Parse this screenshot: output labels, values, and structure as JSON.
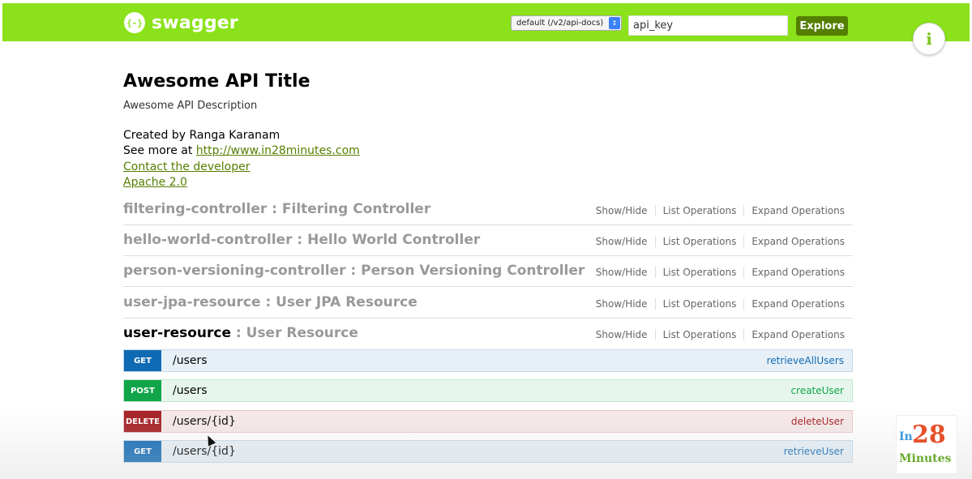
{
  "header": {
    "logo_mark": "{-}",
    "logo_text": "swagger",
    "spec_select_value": "default (/v2/api-docs)",
    "api_key_placeholder": "api_key",
    "explore_label": "Explore",
    "info_icon": "i"
  },
  "info": {
    "title": "Awesome API Title",
    "description": "Awesome API Description",
    "created_by": "Created by Ranga Karanam",
    "see_more_prefix": "See more at ",
    "see_more_link": "http://www.in28minutes.com",
    "contact_link": "Contact the developer",
    "license_link": "Apache 2.0"
  },
  "resource_actions": {
    "show_hide": "Show/Hide",
    "list_operations": "List Operations",
    "expand_operations": "Expand Operations"
  },
  "resources": [
    {
      "name": "filtering-controller",
      "desc": " : Filtering Controller"
    },
    {
      "name": "hello-world-controller",
      "desc": " : Hello World Controller"
    },
    {
      "name": "person-versioning-controller",
      "desc": " : Person Versioning Controller"
    },
    {
      "name": "user-jpa-resource",
      "desc": " : User JPA Resource"
    },
    {
      "name": "user-resource",
      "desc": " : User Resource"
    }
  ],
  "operations": [
    {
      "method": "GET",
      "path": "/users",
      "nickname": "retrieveAllUsers"
    },
    {
      "method": "POST",
      "path": "/users",
      "nickname": "createUser"
    },
    {
      "method": "DELETE",
      "path": "/users/{id}",
      "nickname": "deleteUser"
    },
    {
      "method": "GET",
      "path": "/users/{id}",
      "nickname": "retrieveUser"
    }
  ],
  "watermark": {
    "in": "In",
    "num": "28",
    "minutes": "Minutes"
  },
  "colors": {
    "header_green": "#8be21a",
    "explore_green": "#547f00",
    "get_blue": "#0f6ab4",
    "post_green": "#10a54a",
    "delete_red": "#a41e22"
  }
}
